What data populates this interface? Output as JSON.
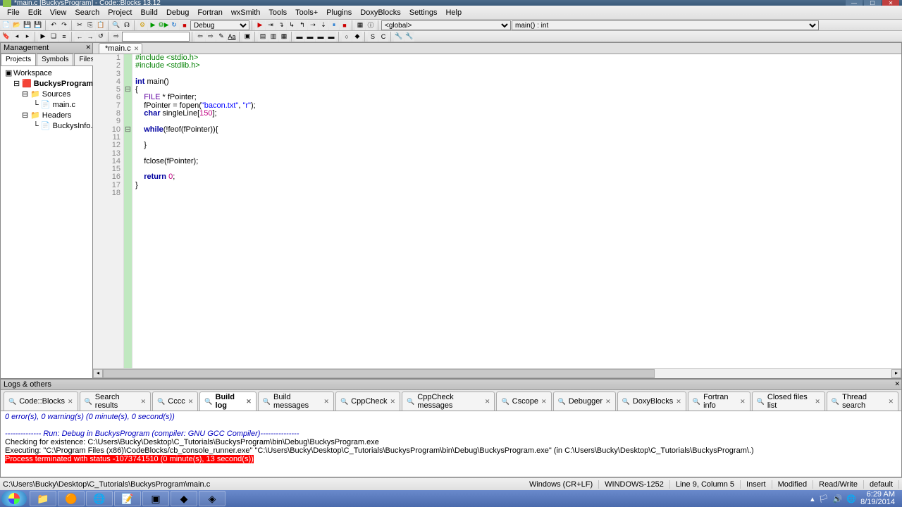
{
  "window": {
    "title": "*main.c [BuckysProgram] - Code::Blocks 13.12",
    "min": "—",
    "max": "☐",
    "close": "✕"
  },
  "menu": [
    "File",
    "Edit",
    "View",
    "Search",
    "Project",
    "Build",
    "Debug",
    "Fortran",
    "wxSmith",
    "Tools",
    "Tools+",
    "Plugins",
    "DoxyBlocks",
    "Settings",
    "Help"
  ],
  "toolbar": {
    "target": "Debug",
    "scope": "<global>",
    "func": "main() : int"
  },
  "mgmt": {
    "title": "Management",
    "tabs": [
      "Projects",
      "Symbols",
      "Files"
    ],
    "tree": {
      "root": "Workspace",
      "project": "BuckysProgram",
      "folders": [
        {
          "name": "Sources",
          "files": [
            "main.c"
          ]
        },
        {
          "name": "Headers",
          "files": [
            "BuckysInfo.h"
          ]
        }
      ]
    }
  },
  "editor": {
    "tab": "*main.c",
    "lines": [
      {
        "n": 1,
        "html": "<span class='k-pp'>#include &lt;stdio.h&gt;</span>"
      },
      {
        "n": 2,
        "html": "<span class='k-pp'>#include &lt;stdlib.h&gt;</span>"
      },
      {
        "n": 3,
        "html": ""
      },
      {
        "n": 4,
        "html": "<span class='k-kw'>int</span> main()"
      },
      {
        "n": 5,
        "html": "{",
        "fold": "⊟"
      },
      {
        "n": 6,
        "html": "    <span class='k-ty'>FILE</span> * fPointer;"
      },
      {
        "n": 7,
        "html": "    fPointer = fopen(<span class='k-str'>\"bacon.txt\"</span>, <span class='k-str'>\"r\"</span>);"
      },
      {
        "n": 8,
        "html": "    <span class='k-kw'>char</span> singleLine[<span class='k-num'>150</span>];"
      },
      {
        "n": 9,
        "html": "    "
      },
      {
        "n": 10,
        "html": "    <span class='k-kw'>while</span>(!feof(fPointer)){",
        "fold": "⊟"
      },
      {
        "n": 11,
        "html": ""
      },
      {
        "n": 12,
        "html": "    }"
      },
      {
        "n": 13,
        "html": ""
      },
      {
        "n": 14,
        "html": "    fclose(fPointer);"
      },
      {
        "n": 15,
        "html": ""
      },
      {
        "n": 16,
        "html": "    <span class='k-kw'>return</span> <span class='k-num'>0</span>;"
      },
      {
        "n": 17,
        "html": "}"
      },
      {
        "n": 18,
        "html": ""
      }
    ]
  },
  "logs": {
    "title": "Logs & others",
    "tabs": [
      "Code::Blocks",
      "Search results",
      "Cccc",
      "Build log",
      "Build messages",
      "CppCheck",
      "CppCheck messages",
      "Cscope",
      "Debugger",
      "DoxyBlocks",
      "Fortran info",
      "Closed files list",
      "Thread search"
    ],
    "active": 3,
    "body": {
      "summary": "0 error(s), 0 warning(s) (0 minute(s), 0 second(s))",
      "run_header": "-------------- Run: Debug in BuckysProgram (compiler: GNU GCC Compiler)---------------",
      "check": "Checking for existence: C:\\Users\\Bucky\\Desktop\\C_Tutorials\\BuckysProgram\\bin\\Debug\\BuckysProgram.exe",
      "exec": "Executing: \"C:\\Program Files (x86)\\CodeBlocks/cb_console_runner.exe\" \"C:\\Users\\Bucky\\Desktop\\C_Tutorials\\BuckysProgram\\bin\\Debug\\BuckysProgram.exe\"  (in C:\\Users\\Bucky\\Desktop\\C_Tutorials\\BuckysProgram\\.)",
      "term": "Process terminated with status -1073741510 (0 minute(s), 13 second(s))"
    }
  },
  "status": {
    "path": "C:\\Users\\Bucky\\Desktop\\C_Tutorials\\BuckysProgram\\main.c",
    "eol": "Windows (CR+LF)",
    "enc": "WINDOWS-1252",
    "pos": "Line 9, Column 5",
    "ins": "Insert",
    "mod": "Modified",
    "rw": "Read/Write",
    "profile": "default"
  },
  "clock": {
    "time": "6:29 AM",
    "date": "8/19/2014"
  }
}
